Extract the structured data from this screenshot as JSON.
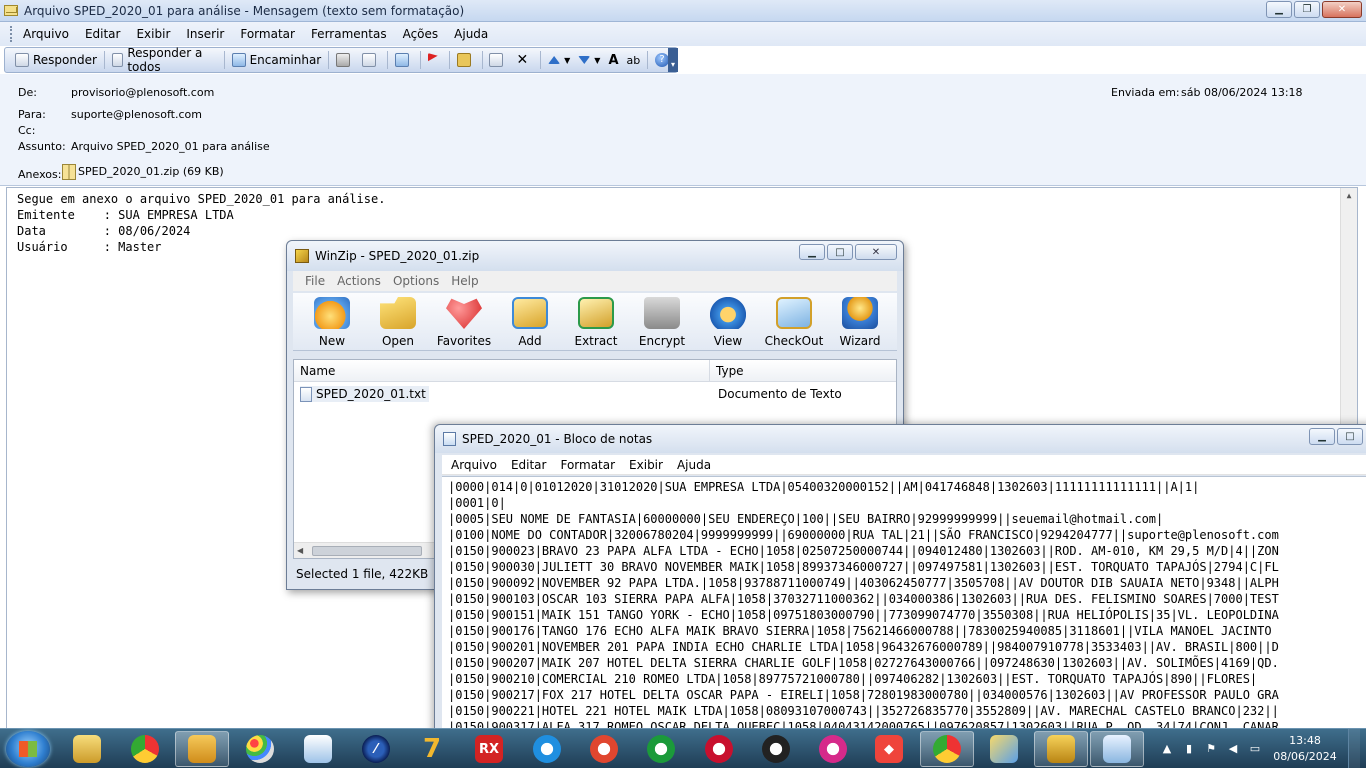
{
  "outlook": {
    "title": "Arquivo SPED_2020_01 para análise - Mensagem (texto sem formatação)",
    "menu": [
      "Arquivo",
      "Editar",
      "Exibir",
      "Inserir",
      "Formatar",
      "Ferramentas",
      "Ações",
      "Ajuda"
    ],
    "toolbar": {
      "reply": "Responder",
      "reply_all": "Responder a todos",
      "forward": "Encaminhar"
    },
    "header": {
      "from_label": "De:",
      "from": "provisorio@plenosoft.com",
      "to_label": "Para:",
      "to": "suporte@plenosoft.com",
      "cc_label": "Cc:",
      "subject_label": "Assunto:",
      "subject": "Arquivo SPED_2020_01 para análise",
      "attach_label": "Anexos:",
      "attachment": "SPED_2020_01.zip (69 KB)",
      "sent_label": "Enviada em:",
      "sent": "sáb 08/06/2024 13:18"
    },
    "body_lines": [
      "Segue em anexo o arquivo SPED_2020_01 para análise.",
      "",
      "Emitente    : SUA EMPRESA LTDA",
      "Data        : 08/06/2024",
      "Usuário     : Master"
    ]
  },
  "winzip": {
    "title": "WinZip - SPED_2020_01.zip",
    "menu": [
      "File",
      "Actions",
      "Options",
      "Help"
    ],
    "buttons": [
      "New",
      "Open",
      "Favorites",
      "Add",
      "Extract",
      "Encrypt",
      "View",
      "CheckOut",
      "Wizard"
    ],
    "columns": [
      "Name",
      "Type"
    ],
    "rows": [
      {
        "name": "SPED_2020_01.txt",
        "type": "Documento de Texto"
      }
    ],
    "status": "Selected 1 file, 422KB"
  },
  "notepad": {
    "title": "SPED_2020_01 - Bloco de notas",
    "menu": [
      "Arquivo",
      "Editar",
      "Formatar",
      "Exibir",
      "Ajuda"
    ],
    "lines": [
      "|0000|014|0|01012020|31012020|SUA EMPRESA LTDA|05400320000152||AM|041746848|1302603|11111111111111||A|1|",
      "|0001|0|",
      "|0005|SEU NOME DE FANTASIA|60000000|SEU ENDEREÇO|100||SEU BAIRRO|92999999999||seuemail@hotmail.com|",
      "|0100|NOME DO CONTADOR|32006780204|9999999999||69000000|RUA TAL|21||SÃO FRANCISCO|9294204777||suporte@plenosoft.com",
      "|0150|900023|BRAVO 23 PAPA ALFA LTDA - ECHO|1058|02507250000744||094012480|1302603||ROD. AM-010, KM 29,5 M/D|4||ZON",
      "|0150|900030|JULIETT 30 BRAVO NOVEMBER MAIK|1058|89937346000727||097497581|1302603||EST. TORQUATO TAPAJÓS|2794|C|FL",
      "|0150|900092|NOVEMBER 92 PAPA LTDA.|1058|93788711000749||403062450777|3505708||AV DOUTOR DIB SAUAIA NETO|9348||ALPH",
      "|0150|900103|OSCAR 103 SIERRA PAPA ALFA|1058|37032711000362||034000386|1302603||RUA DES. FELISMINO SOARES|7000|TEST",
      "|0150|900151|MAIK 151 TANGO YORK - ECHO|1058|09751803000790||773099074770|3550308||RUA HELIÓPOLIS|35|VL. LEOPOLDINA",
      "|0150|900176|TANGO 176 ECHO ALFA MAIK BRAVO SIERRA|1058|75621466000788||7830025940085|3118601||VILA MANOEL JACINTO",
      "|0150|900201|NOVEMBER 201 PAPA INDIA ECHO CHARLIE LTDA|1058|96432676000789||984007910778|3533403||AV. BRASIL|800||D",
      "|0150|900207|MAIK 207 HOTEL DELTA SIERRA CHARLIE GOLF|1058|02727643000766||097248630|1302603||AV. SOLIMÕES|4169|QD.",
      "|0150|900210|COMERCIAL 210 ROMEO LTDA|1058|89775721000780||097406282|1302603||EST. TORQUATO TAPAJÓS|890||FLORES|",
      "|0150|900217|FOX 217 HOTEL DELTA OSCAR PAPA - EIRELI|1058|72801983000780||034000576|1302603||AV PROFESSOR PAULO GRA",
      "|0150|900221|HOTEL 221 HOTEL MAIK LTDA|1058|08093107000743||352726835770|3552809||AV. MARECHAL CASTELO BRANCO|232||",
      "|0150|900317|ALFA 317 ROMEO OSCAR DELTA QUEBEC|1058|04043142000765||097620857|1302603||RUA P. QD. 34|74|CONJ. CANAR"
    ]
  },
  "taskbar": {
    "apps": [
      "explorer",
      "chrome",
      "outlook",
      "paint",
      "notepad-app",
      "firefox",
      "plenosoft-7",
      "rx",
      "app-blue",
      "app-red1",
      "app-green",
      "app-red2",
      "app-dark",
      "app-pink",
      "anydesk",
      "chrome-anix",
      "paint2",
      "winzip",
      "notepad"
    ],
    "tray_icons": [
      "show-hidden",
      "network",
      "volume",
      "flag"
    ],
    "time": "13:48",
    "date": "08/06/2024"
  }
}
